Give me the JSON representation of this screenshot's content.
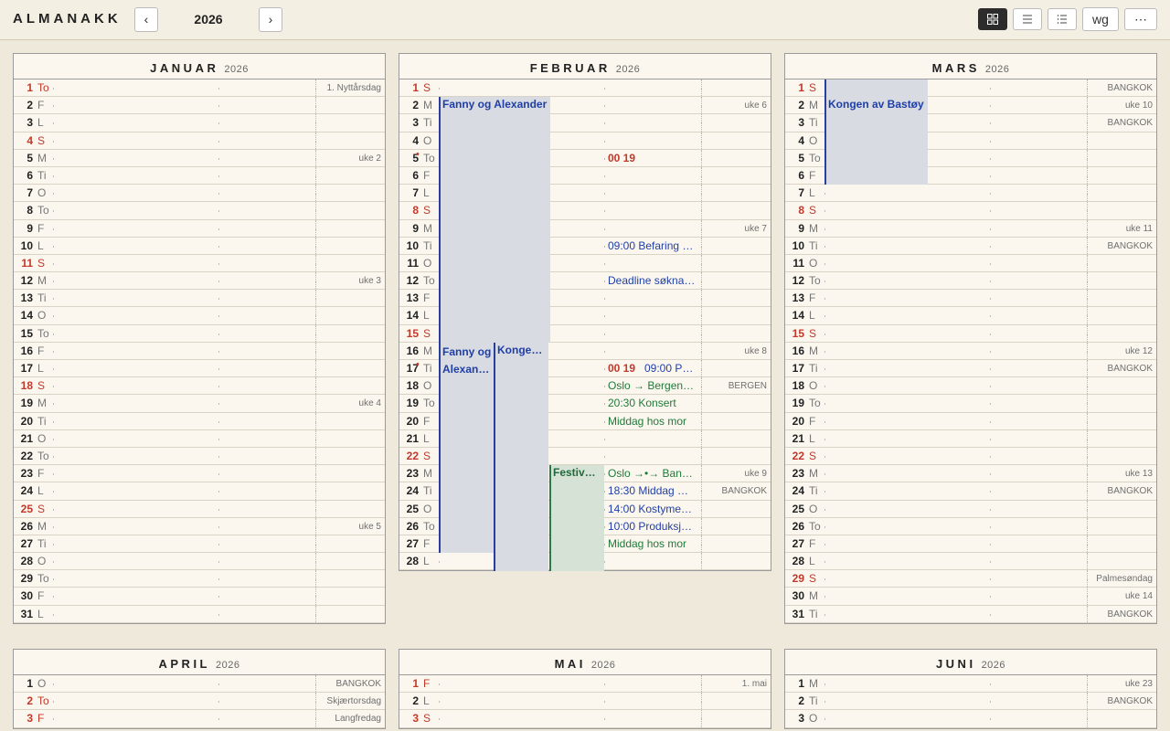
{
  "app": {
    "title": "ALMANAKK",
    "year": "2026",
    "prev": "‹",
    "next": "›"
  },
  "toolbar": {
    "view_grid": "grid-icon",
    "view_list": "list-icon",
    "view_compact": "compact-list-icon",
    "wg_label": "wg",
    "more_label": "⋯"
  },
  "months": [
    {
      "name": "JANUAR",
      "year": "2026",
      "days": [
        {
          "d": "1",
          "wd": "To",
          "red": true,
          "right": "1. Nyttårsdag"
        },
        {
          "d": "2",
          "wd": "F"
        },
        {
          "d": "3",
          "wd": "L"
        },
        {
          "d": "4",
          "wd": "S",
          "red": true
        },
        {
          "d": "5",
          "wd": "M",
          "right": "uke 2"
        },
        {
          "d": "6",
          "wd": "Ti"
        },
        {
          "d": "7",
          "wd": "O"
        },
        {
          "d": "8",
          "wd": "To"
        },
        {
          "d": "9",
          "wd": "F"
        },
        {
          "d": "10",
          "wd": "L"
        },
        {
          "d": "11",
          "wd": "S",
          "red": true
        },
        {
          "d": "12",
          "wd": "M",
          "right": "uke 3"
        },
        {
          "d": "13",
          "wd": "Ti"
        },
        {
          "d": "14",
          "wd": "O"
        },
        {
          "d": "15",
          "wd": "To"
        },
        {
          "d": "16",
          "wd": "F"
        },
        {
          "d": "17",
          "wd": "L"
        },
        {
          "d": "18",
          "wd": "S",
          "red": true
        },
        {
          "d": "19",
          "wd": "M",
          "right": "uke 4"
        },
        {
          "d": "20",
          "wd": "Ti"
        },
        {
          "d": "21",
          "wd": "O"
        },
        {
          "d": "22",
          "wd": "To"
        },
        {
          "d": "23",
          "wd": "F"
        },
        {
          "d": "24",
          "wd": "L"
        },
        {
          "d": "25",
          "wd": "S",
          "red": true
        },
        {
          "d": "26",
          "wd": "M",
          "right": "uke 5"
        },
        {
          "d": "27",
          "wd": "Ti"
        },
        {
          "d": "28",
          "wd": "O"
        },
        {
          "d": "29",
          "wd": "To"
        },
        {
          "d": "30",
          "wd": "F"
        },
        {
          "d": "31",
          "wd": "L"
        }
      ]
    },
    {
      "name": "FEBRUAR",
      "year": "2026",
      "days": [
        {
          "d": "1",
          "wd": "S",
          "red": true
        },
        {
          "d": "2",
          "wd": "M",
          "right": "uke 6"
        },
        {
          "d": "3",
          "wd": "Ti"
        },
        {
          "d": "4",
          "wd": "O"
        },
        {
          "d": "5",
          "wd": "To",
          "dot": true,
          "ev": [
            {
              "t": "00 19",
              "c": "red"
            }
          ]
        },
        {
          "d": "6",
          "wd": "F"
        },
        {
          "d": "7",
          "wd": "L"
        },
        {
          "d": "8",
          "wd": "S",
          "red": true
        },
        {
          "d": "9",
          "wd": "M",
          "right": "uke 7"
        },
        {
          "d": "10",
          "wd": "Ti",
          "ev": [
            {
              "t": "09:00 Befaring …",
              "c": "blue"
            }
          ]
        },
        {
          "d": "11",
          "wd": "O"
        },
        {
          "d": "12",
          "wd": "To",
          "ev": [
            {
              "t": "Deadline søkna…",
              "c": "blue"
            }
          ]
        },
        {
          "d": "13",
          "wd": "F"
        },
        {
          "d": "14",
          "wd": "L"
        },
        {
          "d": "15",
          "wd": "S",
          "red": true
        },
        {
          "d": "16",
          "wd": "M",
          "right": "uke 8"
        },
        {
          "d": "17",
          "wd": "Ti",
          "dot": true,
          "ev": [
            {
              "t": "00 19",
              "c": "red"
            },
            {
              "t": "09:00 P…",
              "c": "blue"
            }
          ]
        },
        {
          "d": "18",
          "wd": "O",
          "right": "BERGEN",
          "ev": [
            {
              "t": "Oslo → Bergen…",
              "c": "green"
            }
          ]
        },
        {
          "d": "19",
          "wd": "To",
          "ev": [
            {
              "t": "20:30 Konsert",
              "c": "green"
            }
          ]
        },
        {
          "d": "20",
          "wd": "F",
          "ev": [
            {
              "t": "Middag hos mor",
              "c": "green"
            }
          ]
        },
        {
          "d": "21",
          "wd": "L"
        },
        {
          "d": "22",
          "wd": "S",
          "red": true
        },
        {
          "d": "23",
          "wd": "M",
          "right": "uke 9",
          "ev": [
            {
              "t": "Oslo →•→ Ban…",
              "c": "green"
            }
          ]
        },
        {
          "d": "24",
          "wd": "Ti",
          "right": "BANGKOK",
          "ev": [
            {
              "t": "18:30 Middag …",
              "c": "blue"
            }
          ]
        },
        {
          "d": "25",
          "wd": "O",
          "ev": [
            {
              "t": "14:00 Kostyme…",
              "c": "blue"
            }
          ]
        },
        {
          "d": "26",
          "wd": "To",
          "ev": [
            {
              "t": "10:00 Produksj…",
              "c": "blue"
            }
          ]
        },
        {
          "d": "27",
          "wd": "F",
          "ev": [
            {
              "t": "Middag hos mor",
              "c": "green"
            }
          ]
        },
        {
          "d": "28",
          "wd": "L"
        }
      ],
      "bars": [
        {
          "label": "Fanny og Alexander",
          "from": 2,
          "to": 15,
          "col": 0,
          "g": false
        },
        {
          "label": "Fanny og Alexan…",
          "from": 16,
          "to": 27,
          "col": 0,
          "g": false,
          "wrap": true
        },
        {
          "label": "Kongen av Bastøy",
          "from": 16,
          "to": 28,
          "col": 1,
          "g": false
        },
        {
          "label": "Festiv…",
          "from": 23,
          "to": 28,
          "col": 2,
          "g": true
        }
      ]
    },
    {
      "name": "MARS",
      "year": "2026",
      "days": [
        {
          "d": "1",
          "wd": "S",
          "red": true,
          "right": "BANGKOK"
        },
        {
          "d": "2",
          "wd": "M",
          "right": "uke 10"
        },
        {
          "d": "3",
          "wd": "Ti",
          "right": "BANGKOK"
        },
        {
          "d": "4",
          "wd": "O"
        },
        {
          "d": "5",
          "wd": "To"
        },
        {
          "d": "6",
          "wd": "F"
        },
        {
          "d": "7",
          "wd": "L"
        },
        {
          "d": "8",
          "wd": "S",
          "red": true
        },
        {
          "d": "9",
          "wd": "M",
          "right": "uke 11"
        },
        {
          "d": "10",
          "wd": "Ti",
          "right": "BANGKOK"
        },
        {
          "d": "11",
          "wd": "O"
        },
        {
          "d": "12",
          "wd": "To"
        },
        {
          "d": "13",
          "wd": "F"
        },
        {
          "d": "14",
          "wd": "L"
        },
        {
          "d": "15",
          "wd": "S",
          "red": true
        },
        {
          "d": "16",
          "wd": "M",
          "right": "uke 12"
        },
        {
          "d": "17",
          "wd": "Ti",
          "right": "BANGKOK"
        },
        {
          "d": "18",
          "wd": "O"
        },
        {
          "d": "19",
          "wd": "To"
        },
        {
          "d": "20",
          "wd": "F"
        },
        {
          "d": "21",
          "wd": "L"
        },
        {
          "d": "22",
          "wd": "S",
          "red": true
        },
        {
          "d": "23",
          "wd": "M",
          "right": "uke 13"
        },
        {
          "d": "24",
          "wd": "Ti",
          "right": "BANGKOK"
        },
        {
          "d": "25",
          "wd": "O"
        },
        {
          "d": "26",
          "wd": "To"
        },
        {
          "d": "27",
          "wd": "F"
        },
        {
          "d": "28",
          "wd": "L"
        },
        {
          "d": "29",
          "wd": "S",
          "red": true,
          "right": "Palmesøndag"
        },
        {
          "d": "30",
          "wd": "M",
          "right": "uke 14"
        },
        {
          "d": "31",
          "wd": "Ti",
          "right": "BANGKOK"
        }
      ],
      "bars": [
        {
          "label": "",
          "from": 1,
          "to": 1,
          "col": 0,
          "g": false,
          "wide": true
        },
        {
          "label": "Kongen av Bastøy",
          "from": 2,
          "to": 6,
          "col": 0,
          "g": false,
          "wide": true
        }
      ]
    },
    {
      "name": "APRIL",
      "year": "2026",
      "days": [
        {
          "d": "1",
          "wd": "O",
          "right": "BANGKOK"
        },
        {
          "d": "2",
          "wd": "To",
          "red": true,
          "right": "Skjærtorsdag"
        },
        {
          "d": "3",
          "wd": "F",
          "red": true,
          "right": "Langfredag"
        }
      ]
    },
    {
      "name": "MAI",
      "year": "2026",
      "days": [
        {
          "d": "1",
          "wd": "F",
          "red": true,
          "right": "1. mai"
        },
        {
          "d": "2",
          "wd": "L"
        },
        {
          "d": "3",
          "wd": "S",
          "red": true
        }
      ]
    },
    {
      "name": "JUNI",
      "year": "2026",
      "days": [
        {
          "d": "1",
          "wd": "M",
          "right": "uke 23"
        },
        {
          "d": "2",
          "wd": "Ti",
          "right": "BANGKOK"
        },
        {
          "d": "3",
          "wd": "O"
        }
      ]
    }
  ]
}
